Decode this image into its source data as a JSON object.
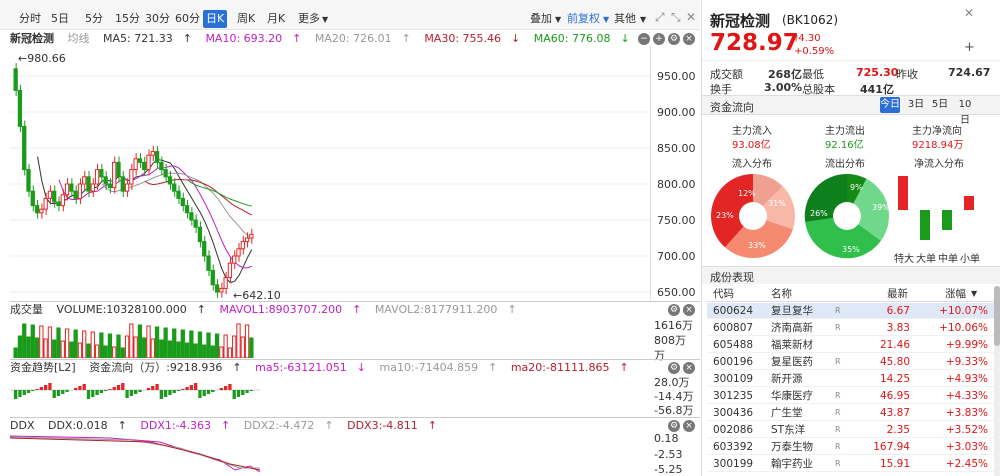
{
  "toolbar": {
    "tabs": [
      "分时",
      "5日",
      "5分",
      "15分",
      "30分",
      "60分",
      "日K",
      "周K",
      "月K",
      "更多"
    ],
    "active_tab": "日K",
    "right": {
      "overlay": "叠加",
      "adjust": "前复权",
      "other": "其他"
    }
  },
  "main_header": {
    "name": "新冠检测",
    "ma_label": "均线",
    "ma5": "MA5: 721.33",
    "ma10": "MA10: 693.20",
    "ma20": "MA20: 726.01",
    "ma30": "MA30: 755.46",
    "ma60": "MA60: 776.08",
    "max_label": "980.66",
    "min_label": "642.10",
    "yticks": [
      "950.00",
      "900.00",
      "850.00",
      "800.00",
      "750.00",
      "700.00",
      "650.00"
    ]
  },
  "volume": {
    "label": "成交量",
    "volume": "VOLUME:10328100.000",
    "mavol1": "MAVOL1:8903707.200",
    "mavol2": "MAVOL2:8177911.200",
    "yticks": [
      "1616万",
      "808万",
      "万"
    ]
  },
  "capital": {
    "label": "资金趋势[L2]",
    "cap": "资金流向（万）:9218.936",
    "ma5": "ma5:-63121.051",
    "ma10": "ma10:-71404.859",
    "ma20": "ma20:-81111.865",
    "yticks": [
      "28.0万",
      "-14.4万",
      "-56.8万"
    ]
  },
  "ddx": {
    "label": "DDX",
    "ddx": "DDX:0.018",
    "ddx1": "DDX1:-4.363",
    "ddx2": "DDX2:-4.472",
    "ddx3": "DDX3:-4.811",
    "yticks": [
      "0.18",
      "-2.53",
      "-5.25"
    ]
  },
  "quote": {
    "name": "新冠检测",
    "code": "(BK1062)",
    "price": "728.97",
    "change": "4.30",
    "pct": "+0.59%",
    "row1": {
      "l1": "成交额",
      "v1": "268亿",
      "l2": "最低",
      "v2": "725.30",
      "l3": "昨收",
      "v3": "724.67"
    },
    "row2": {
      "l1": "换手",
      "v1": "3.00%",
      "l2": "总股本",
      "v2": "441亿"
    }
  },
  "flow": {
    "title": "资金流向",
    "periods": [
      "今日",
      "3日",
      "5日",
      "10日"
    ],
    "in_label": "主力流入",
    "in_val": "93.08亿",
    "out_label": "主力流出",
    "out_val": "92.16亿",
    "net_label": "主力净流向",
    "net_val": "9218.94万",
    "dist_in": "流入分布",
    "dist_out": "流出分布",
    "dist_net": "净流入分布",
    "pie_in": [
      "12%",
      "31%",
      "33%",
      "23%"
    ],
    "pie_out": [
      "9%",
      "39%",
      "35%",
      "26%"
    ],
    "bar_labels": [
      "特大",
      "大单",
      "中单",
      "小单"
    ]
  },
  "stocks": {
    "title": "成份表现",
    "headers": [
      "代码",
      "名称",
      "最新",
      "涨幅"
    ],
    "rows": [
      {
        "code": "600624",
        "name": "复旦复华",
        "r": "R",
        "price": "6.67",
        "pct": "+10.07%"
      },
      {
        "code": "600807",
        "name": "济南高新",
        "r": "R",
        "price": "3.83",
        "pct": "+10.06%"
      },
      {
        "code": "605488",
        "name": "福莱新材",
        "r": "",
        "price": "21.46",
        "pct": "+9.99%"
      },
      {
        "code": "600196",
        "name": "复星医药",
        "r": "R",
        "price": "45.80",
        "pct": "+9.33%"
      },
      {
        "code": "300109",
        "name": "新开源",
        "r": "",
        "price": "14.25",
        "pct": "+4.93%"
      },
      {
        "code": "301235",
        "name": "华康医疗",
        "r": "R",
        "price": "46.95",
        "pct": "+4.33%"
      },
      {
        "code": "300436",
        "name": "广生堂",
        "r": "R",
        "price": "43.87",
        "pct": "+3.83%"
      },
      {
        "code": "002086",
        "name": "ST东洋",
        "r": "R",
        "price": "2.35",
        "pct": "+3.52%"
      },
      {
        "code": "603392",
        "name": "万泰生物",
        "r": "R",
        "price": "167.94",
        "pct": "+3.03%"
      },
      {
        "code": "300199",
        "name": "翰宇药业",
        "r": "R",
        "price": "15.91",
        "pct": "+2.45%"
      }
    ]
  }
}
